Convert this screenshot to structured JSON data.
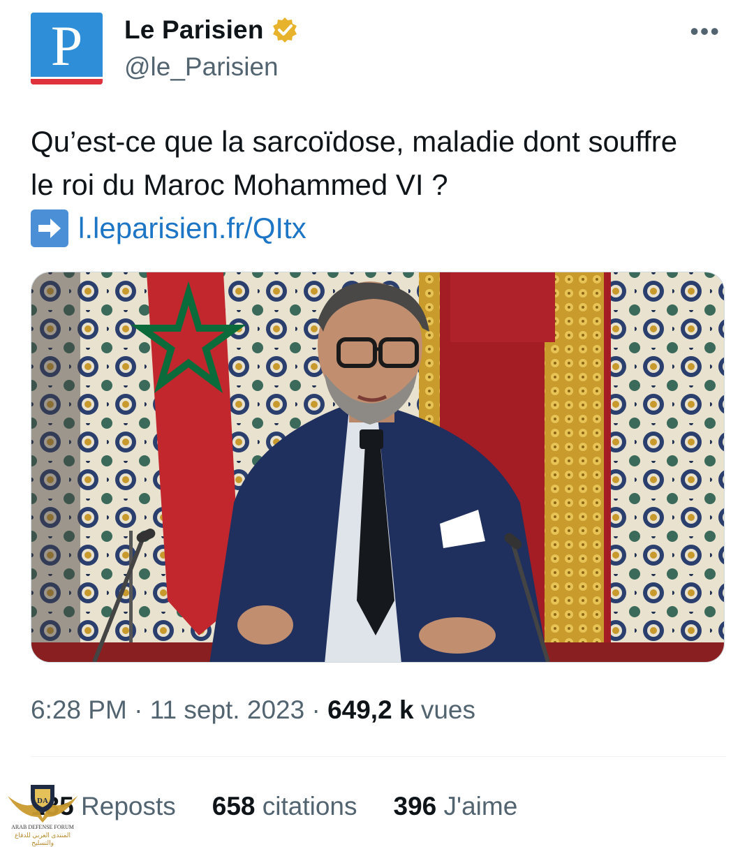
{
  "account": {
    "avatar_letter": "P",
    "name": "Le Parisien",
    "handle": "@le_Parisien",
    "verified": true,
    "more_label": "•••"
  },
  "tweet": {
    "text": "Qu’est-ce que la sarcoïdose, maladie dont souffre le roi du Maroc Mohammed VI ?",
    "link_text": "l.leparisien.fr/QItx"
  },
  "meta": {
    "time": "6:28 PM",
    "separator": "·",
    "date": "11 sept. 2023",
    "views_count": "649,2 k",
    "views_label": "vues"
  },
  "stats": [
    {
      "count": "135",
      "label": "Reposts"
    },
    {
      "count": "658",
      "label": "citations"
    },
    {
      "count": "396",
      "label": "J'aime"
    }
  ],
  "watermark": {
    "logo_text": "DA",
    "forum_name": "ARAB DEFENSE FORUM",
    "arabic_name": "المنتدى العربي للدفاع والتسليح"
  },
  "colors": {
    "avatar_blue": "#2e8fd8",
    "avatar_red": "#e0323b",
    "link": "#1d75c6",
    "verified_gold": "#e8b32c",
    "muted_text": "#536471"
  }
}
